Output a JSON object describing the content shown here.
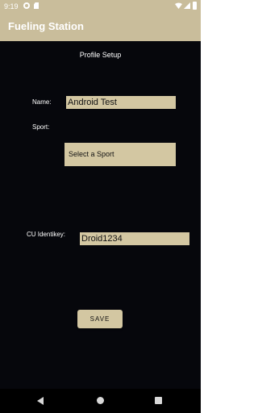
{
  "status_bar": {
    "time": "9:19",
    "icons": [
      "sync-icon",
      "sdcard-icon",
      "wifi-icon",
      "signal-icon",
      "battery-icon"
    ]
  },
  "app_bar": {
    "title": "Fueling Station"
  },
  "form": {
    "page_title": "Profile Setup",
    "name_label": "Name:",
    "name_value": "Android Test",
    "sport_label": "Sport:",
    "sport_selected": "Select a Sport",
    "identikey_label": "CU Identikey:",
    "identikey_value": "Droid1234",
    "save_label": "SAVE"
  },
  "nav_bar": {
    "icons": [
      "back-icon",
      "home-icon",
      "recents-icon"
    ]
  },
  "colors": {
    "accent": "#c9bd9b",
    "field_background": "#d3c7a2",
    "background": "#06070c"
  }
}
